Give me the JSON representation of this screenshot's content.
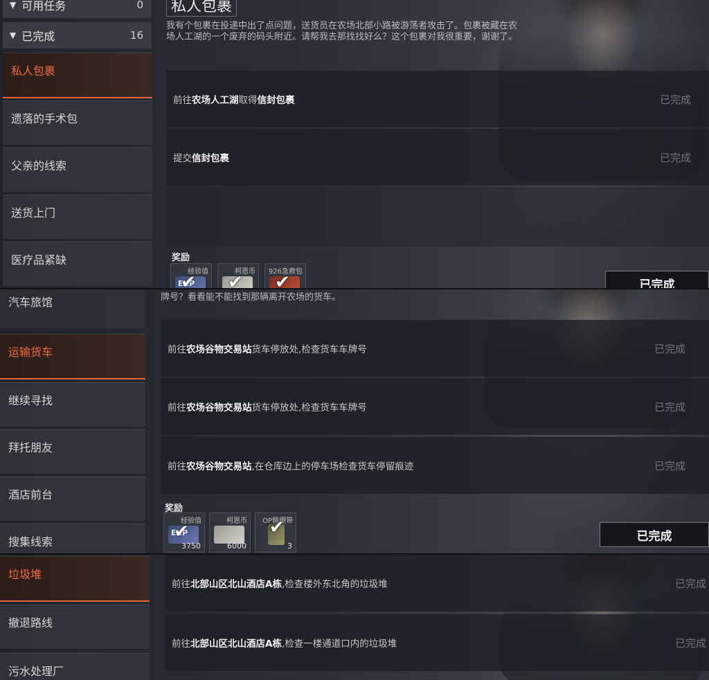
{
  "p1": {
    "groups": [
      {
        "label": "可用任务",
        "count": "0"
      },
      {
        "label": "已完成",
        "count": "16"
      }
    ],
    "side_items": [
      "私人包裹",
      "遗落的手术包",
      "父亲的线索",
      "送货上门",
      "医疗品紧缺"
    ],
    "title": "私人包裹",
    "desc": "我有个包裹在投递中出了点问题，送货员在农场北部小路被游荡者攻击了。包裹被藏在农场人工湖的一个废弃的码头附近。请帮我去那找找好么？这个包裹对我很重要，谢谢了。",
    "objectives": [
      {
        "pre": "前往",
        "bold1": "农场人工湖",
        "mid": "取得",
        "bold2": "信封包裹",
        "post": "",
        "status": "已完成"
      },
      {
        "pre": "提交",
        "bold1": "信封包裹",
        "mid": "",
        "bold2": "",
        "post": "",
        "status": "已完成"
      }
    ],
    "reward_label": "奖励",
    "rewards": [
      {
        "name": "经验值",
        "qty": "",
        "icon": "exp-icon",
        "icon_text": "EXP"
      },
      {
        "name": "柯恩币",
        "qty": "",
        "icon": "cash-icon",
        "icon_text": ""
      },
      {
        "name": "926急救包",
        "qty": "",
        "icon": "aid-icon",
        "icon_text": ""
      }
    ],
    "done_btn": "已完成"
  },
  "p2": {
    "side_items": [
      "汽车旅馆",
      "运输货车",
      "继续寻找",
      "拜托朋友",
      "酒店前台",
      "搜集线索"
    ],
    "desc_tail": "牌号？看看能不能找到那辆离开农场的货车。",
    "objectives": [
      {
        "pre": "前往",
        "bold1": "农场谷物交易站",
        "mid": "货车停放处,检查货车车牌号",
        "bold2": "",
        "post": "",
        "status": "已完成"
      },
      {
        "pre": "前往",
        "bold1": "农场谷物交易站",
        "mid": "货车停放处,检查货车车牌号",
        "bold2": "",
        "post": "",
        "status": "已完成"
      },
      {
        "pre": "前往",
        "bold1": "农场谷物交易站",
        "mid": ",在仓库边上的停车场检查货车停留痕迹",
        "bold2": "",
        "post": "",
        "status": "已完成"
      }
    ],
    "reward_label": "奖励",
    "rewards": [
      {
        "name": "经验值",
        "qty": "3750",
        "icon": "exp-icon",
        "icon_text": "EXP"
      },
      {
        "name": "柯恩币",
        "qty": "6000",
        "icon": "cash-icon",
        "icon_text": ""
      },
      {
        "name": "OP骼绷带",
        "qty": "3",
        "icon": "bandage-icon",
        "icon_text": ""
      }
    ],
    "done_btn": "已完成"
  },
  "p3": {
    "side_items": [
      "垃圾堆",
      "撤退路线",
      "污水处理厂"
    ],
    "objectives": [
      {
        "pre": "前往",
        "bold1": "北部山区北山酒店A栋",
        "mid": ",检查楼外东北角的垃圾堆",
        "bold2": "",
        "post": "",
        "status": "已完成"
      },
      {
        "pre": "前往",
        "bold1": "北部山区北山酒店A栋",
        "mid": ",检查一楼通道口内的垃圾堆",
        "bold2": "",
        "post": "",
        "status": "已完成"
      }
    ]
  },
  "colors": {
    "accent": "#e8643a",
    "done_text": "#6f747b"
  }
}
